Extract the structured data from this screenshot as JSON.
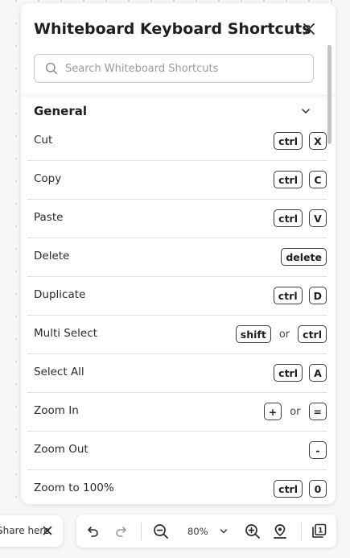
{
  "panel": {
    "title": "Whiteboard Keyboard Shortcuts",
    "search_placeholder": "Search Whiteboard Shortcuts"
  },
  "section": {
    "title": "General",
    "shortcuts": [
      {
        "label": "Cut",
        "keys": [
          "ctrl",
          "X"
        ]
      },
      {
        "label": "Copy",
        "keys": [
          "ctrl",
          "C"
        ]
      },
      {
        "label": "Paste",
        "keys": [
          "ctrl",
          "V"
        ]
      },
      {
        "label": "Delete",
        "keys": [
          "delete"
        ]
      },
      {
        "label": "Duplicate",
        "keys": [
          "ctrl",
          "D"
        ]
      },
      {
        "label": "Multi Select",
        "keys": [
          "shift",
          "ctrl"
        ],
        "separator": "or"
      },
      {
        "label": "Select All",
        "keys": [
          "ctrl",
          "A"
        ]
      },
      {
        "label": "Zoom In",
        "keys": [
          "+",
          "="
        ],
        "separator": "or"
      },
      {
        "label": "Zoom Out",
        "keys": [
          "-"
        ]
      },
      {
        "label": "Zoom to 100%",
        "keys": [
          "ctrl",
          "0"
        ]
      }
    ]
  },
  "share": {
    "text": "Share here"
  },
  "toolbar": {
    "zoom_level": "80%",
    "pages_count": "1"
  }
}
